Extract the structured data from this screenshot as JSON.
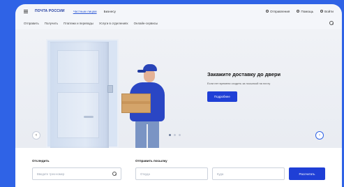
{
  "topbar": {
    "logo": "ПОЧТА РОССИИ",
    "segment_private": "Частным лицам",
    "segment_business": "Бизнесу",
    "track_link": "Отправления",
    "help_link": "Помощь",
    "login_link": "Войти"
  },
  "nav": {
    "items": [
      "Отправить",
      "Получить",
      "Платежи и переводы",
      "Услуги в отделениях",
      "Онлайн-сервисы"
    ]
  },
  "promo": {
    "title": "Закажите доставку до двери",
    "text": "Если нет времени сходить за посылкой на почту",
    "button": "Подробнее"
  },
  "carousel": {
    "prev_glyph": "‹",
    "next_glyph": "›"
  },
  "tracking": {
    "label": "Отследить",
    "placeholder": "Введите трек-номер"
  },
  "send": {
    "label": "Отправить посылку",
    "from_placeholder": "Откуда",
    "to_placeholder": "Куда",
    "button": "Рассчитать"
  },
  "colors": {
    "accent": "#1f3fd6",
    "background": "#2f63e6"
  }
}
